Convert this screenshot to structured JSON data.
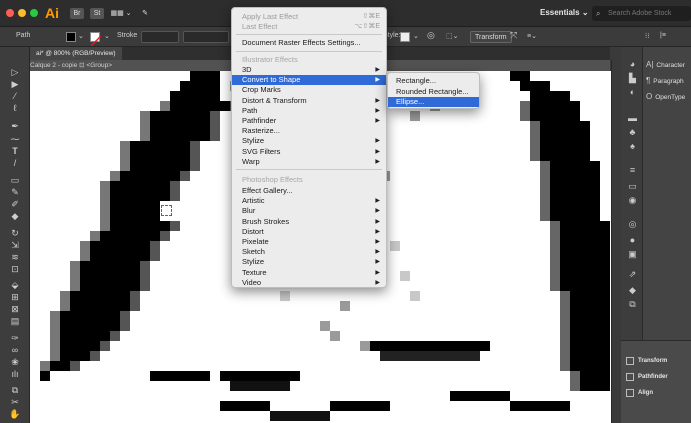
{
  "app": {
    "logo": "Ai",
    "workspace": "Essentials",
    "workspace_arrow": "⌄",
    "search_placeholder": "Search Adobe Stock",
    "top_icons": [
      "Br",
      "St",
      "▦▦ ⌄",
      "✎"
    ]
  },
  "control_bar": {
    "selection_label": "Path",
    "stroke_label": "Stroke",
    "style_label": "Style:",
    "transform_label": "Transform"
  },
  "document": {
    "tab_title": "ai* @ 800% (RGB/Preview)",
    "breadcrumb": "Calque 2 - copie  ⊡ <Group>"
  },
  "effect_menu": {
    "apply_last": {
      "label": "Apply Last Effect",
      "shortcut": "⇧⌘E"
    },
    "last_effect": {
      "label": "Last Effect",
      "shortcut": "⌥⇧⌘E"
    },
    "document_raster": "Document Raster Effects Settings...",
    "illustrator_header": "Illustrator Effects",
    "illustrator_items": [
      {
        "label": "3D",
        "submenu": true
      },
      {
        "label": "Convert to Shape",
        "submenu": true,
        "highlighted": true
      },
      {
        "label": "Crop Marks",
        "submenu": false
      },
      {
        "label": "Distort & Transform",
        "submenu": true
      },
      {
        "label": "Path",
        "submenu": true
      },
      {
        "label": "Pathfinder",
        "submenu": true
      },
      {
        "label": "Rasterize...",
        "submenu": false
      },
      {
        "label": "Stylize",
        "submenu": true
      },
      {
        "label": "SVG Filters",
        "submenu": true
      },
      {
        "label": "Warp",
        "submenu": true
      }
    ],
    "photoshop_header": "Photoshop Effects",
    "photoshop_items": [
      {
        "label": "Effect Gallery...",
        "submenu": false
      },
      {
        "label": "Artistic",
        "submenu": true
      },
      {
        "label": "Blur",
        "submenu": true
      },
      {
        "label": "Brush Strokes",
        "submenu": true
      },
      {
        "label": "Distort",
        "submenu": true
      },
      {
        "label": "Pixelate",
        "submenu": true
      },
      {
        "label": "Sketch",
        "submenu": true
      },
      {
        "label": "Stylize",
        "submenu": true
      },
      {
        "label": "Texture",
        "submenu": true
      },
      {
        "label": "Video",
        "submenu": true
      }
    ]
  },
  "convert_submenu": {
    "items": [
      {
        "label": "Rectangle...",
        "highlighted": false
      },
      {
        "label": "Rounded Rectangle...",
        "highlighted": false
      },
      {
        "label": "Ellipse...",
        "highlighted": true
      }
    ]
  },
  "right_panels": {
    "top": [
      {
        "icon": "A|",
        "label": "Character"
      },
      {
        "icon": "¶",
        "label": "Paragraph"
      },
      {
        "icon": "O",
        "label": "OpenType"
      }
    ],
    "bottom": [
      {
        "label": "Transform"
      },
      {
        "label": "Pathfinder"
      },
      {
        "label": "Align"
      }
    ]
  },
  "colors": {
    "menu_highlight": "#2f6ad8",
    "accent_logo": "#ff9a00"
  }
}
